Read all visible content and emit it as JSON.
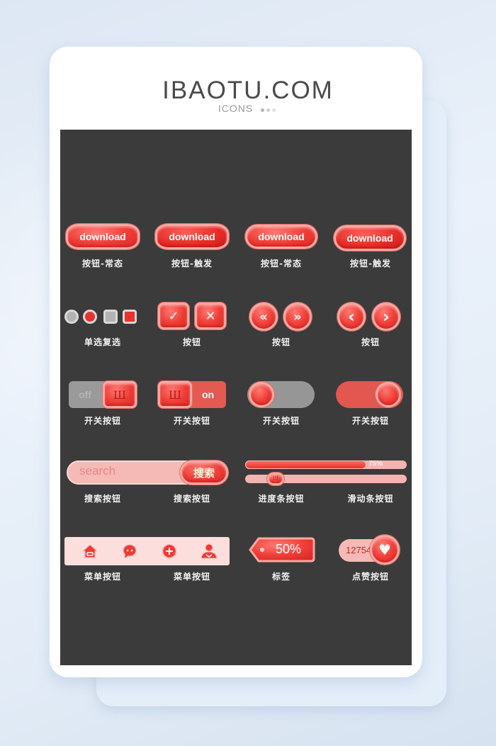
{
  "header": {
    "brand": "IBAOTU.COM",
    "subtitle": "ICONS",
    "dot_colors": [
      "#b5b5b5",
      "#cfcfcf",
      "#e2e2e2"
    ]
  },
  "colors": {
    "accent_red": "#e8322d",
    "light_pink": "#f5b9b6",
    "panel_bg": "#3b3b3b",
    "off_gray": "#9a9a9a"
  },
  "rows": {
    "download": {
      "buttons": [
        {
          "text": "download",
          "label": "按钮-常态"
        },
        {
          "text": "download",
          "label": "按钮-触发"
        },
        {
          "text": "download",
          "label": "按钮-常态"
        },
        {
          "text": "download",
          "label": "按钮-触发"
        }
      ]
    },
    "controls": {
      "radio_checkbox_label": "单选复选",
      "confirm_buttons": {
        "confirm_icon": "check-icon",
        "cancel_icon": "close-icon",
        "check_glyph": "✓",
        "close_glyph": "✕",
        "label": "按钮"
      },
      "double_arrows": {
        "prev_glyph": "«",
        "next_glyph": "»",
        "label": "按钮"
      },
      "single_arrows": {
        "prev_glyph": "‹",
        "next_glyph": "›",
        "label": "按钮"
      }
    },
    "toggles": [
      {
        "state": "off",
        "text": "off",
        "knob_glyph": "Ш",
        "label": "开关按钮"
      },
      {
        "state": "on",
        "text": "on",
        "knob_glyph": "Ш",
        "label": "开关按钮"
      },
      {
        "state": "off",
        "label": "开关按钮"
      },
      {
        "state": "on",
        "label": "开关按钮"
      }
    ],
    "search": {
      "placeholder": "search",
      "button": "搜索",
      "label_left": "搜索按钮",
      "label_right": "搜索按钮"
    },
    "sliders": {
      "progress_percent": 75,
      "progress_text": "75%",
      "slider_value": 0.15,
      "thumb_glyph": "III",
      "progress_label": "进度条按钮",
      "slider_label": "滑动条按钮"
    },
    "menu": {
      "items": [
        {
          "icon": "home-icon",
          "glyph": "⌂"
        },
        {
          "icon": "chat-icon",
          "glyph": "••"
        },
        {
          "icon": "add-icon",
          "glyph": "+"
        },
        {
          "icon": "user-icon",
          "glyph": "👤"
        }
      ],
      "label_left": "菜单按钮",
      "label_right": "菜单按钮"
    },
    "tag": {
      "text": "50%",
      "label": "标签"
    },
    "like": {
      "count": "12754",
      "glyph": "♥",
      "label": "点赞按钮"
    }
  }
}
